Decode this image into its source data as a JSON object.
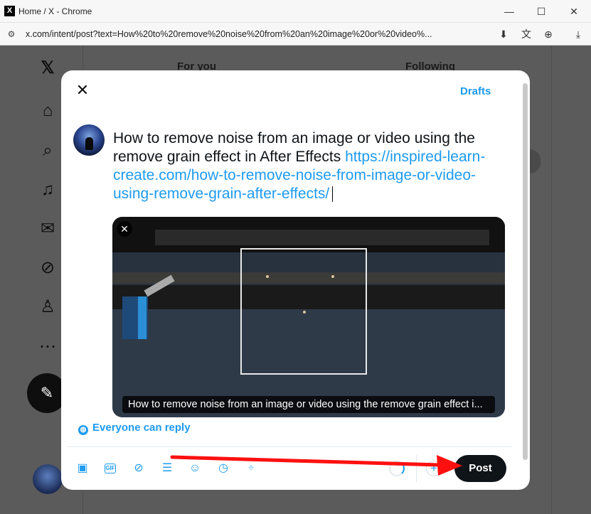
{
  "browser": {
    "title": "Home / X - Chrome",
    "url": "x.com/intent/post?text=How%20to%20remove%20noise%20from%20an%20image%20or%20video%...",
    "controls": {
      "minimize": "—",
      "maximize": "☐",
      "close": "✕"
    }
  },
  "background_page": {
    "tabs": [
      {
        "label": "For you"
      },
      {
        "label": "Following"
      }
    ]
  },
  "modal": {
    "drafts_label": "Drafts",
    "post_text": "How to remove noise from an image or video using the remove grain effect in After Effects ",
    "post_link": "https://inspired-learn-create.com/how-to-remove-noise-from-image-or-video-using-remove-grain-after-effects/",
    "media_caption": "How to remove noise from an image or video using the remove grain effect i...",
    "reply_setting": "Everyone can reply",
    "post_button": "Post"
  },
  "colors": {
    "accent": "#1d9bf0",
    "post_button_bg": "#0f1419",
    "overlay": "#5b5b5b",
    "annotation_arrow": "#ff1010"
  },
  "icons": {
    "nav": [
      "x-logo-icon",
      "home-icon",
      "search-icon",
      "notifications-icon",
      "messages-icon",
      "grok-icon",
      "profile-icon",
      "more-icon",
      "compose-icon"
    ],
    "toolbar": [
      "media-icon",
      "gif-icon",
      "grok-icon",
      "poll-icon",
      "emoji-icon",
      "schedule-icon",
      "location-icon"
    ]
  }
}
